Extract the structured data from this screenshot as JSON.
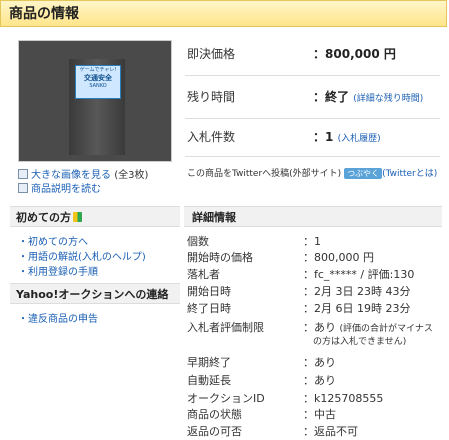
{
  "header": {
    "title": "商品の情報"
  },
  "image": {
    "pkg_lines": [
      "ゲームでチャレ!",
      "交通安全",
      "SANKO"
    ],
    "links": [
      "大きな画像を見る",
      "(全3枚)",
      "商品説明を読む"
    ]
  },
  "summary": {
    "price_label": "即決価格",
    "price_value": "800,000 円",
    "time_label": "残り時間",
    "time_value": "終了",
    "time_note": "(詳細な残り時間)",
    "bids_label": "入札件数",
    "bids_value": "1",
    "bids_note": "(入札履歴)",
    "twitter_text": "この商品をTwitterへ投稿(外部サイト)",
    "twitter_button": "つぶやく",
    "twitter_help": "(Twitterとは)"
  },
  "sidebar": {
    "beginner_title": "初めての方",
    "beginner_items": [
      "初めての方へ",
      "用語の解説(入札のヘルプ)",
      "利用登録の手順"
    ],
    "contact_title": "Yahoo!オークションへの連絡",
    "contact_items": [
      "違反商品の申告"
    ]
  },
  "details": {
    "title": "詳細情報",
    "rows": [
      {
        "label": "個数",
        "value": "1"
      },
      {
        "label": "開始時の価格",
        "value": "800,000 円"
      },
      {
        "label": "落札者",
        "value": "fc_***** / 評価:130"
      },
      {
        "label": "開始日時",
        "value": "2月 3日 23時 43分"
      },
      {
        "label": "終了日時",
        "value": "2月 6日 19時 23分"
      },
      {
        "label": "入札者評価制限",
        "value": "あり",
        "note1": "(評価の合計がマイナス",
        "note2": "の方は入札できません)"
      },
      {
        "label": "早期終了",
        "value": "あり"
      },
      {
        "label": "自動延長",
        "value": "あり"
      },
      {
        "label": "オークションID",
        "value": "k125708555"
      },
      {
        "label": "商品の状態",
        "value": "中古"
      },
      {
        "label": "返品の可否",
        "value": "返品不可"
      }
    ]
  }
}
